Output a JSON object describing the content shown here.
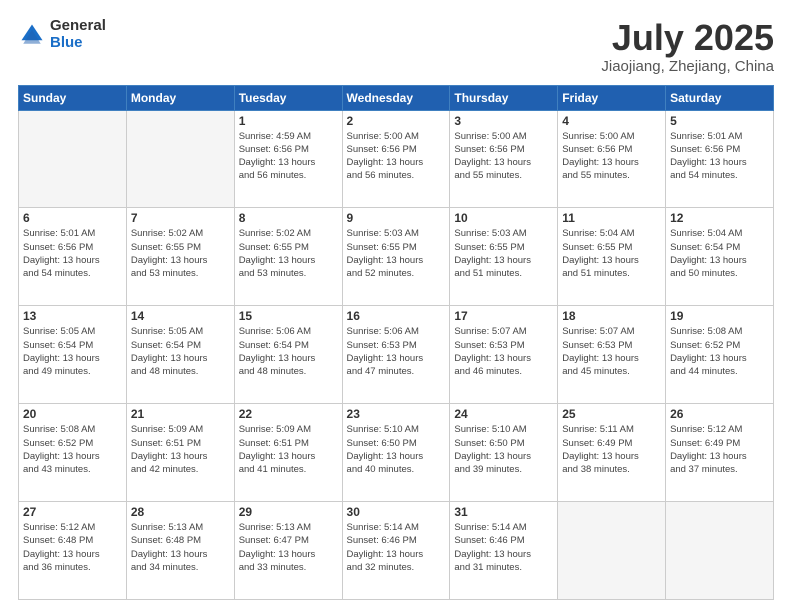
{
  "logo": {
    "general": "General",
    "blue": "Blue"
  },
  "title": {
    "month": "July 2025",
    "location": "Jiaojiang, Zhejiang, China"
  },
  "days_header": [
    "Sunday",
    "Monday",
    "Tuesday",
    "Wednesday",
    "Thursday",
    "Friday",
    "Saturday"
  ],
  "weeks": [
    [
      {
        "day": "",
        "info": ""
      },
      {
        "day": "",
        "info": ""
      },
      {
        "day": "1",
        "info": "Sunrise: 4:59 AM\nSunset: 6:56 PM\nDaylight: 13 hours\nand 56 minutes."
      },
      {
        "day": "2",
        "info": "Sunrise: 5:00 AM\nSunset: 6:56 PM\nDaylight: 13 hours\nand 56 minutes."
      },
      {
        "day": "3",
        "info": "Sunrise: 5:00 AM\nSunset: 6:56 PM\nDaylight: 13 hours\nand 55 minutes."
      },
      {
        "day": "4",
        "info": "Sunrise: 5:00 AM\nSunset: 6:56 PM\nDaylight: 13 hours\nand 55 minutes."
      },
      {
        "day": "5",
        "info": "Sunrise: 5:01 AM\nSunset: 6:56 PM\nDaylight: 13 hours\nand 54 minutes."
      }
    ],
    [
      {
        "day": "6",
        "info": "Sunrise: 5:01 AM\nSunset: 6:56 PM\nDaylight: 13 hours\nand 54 minutes."
      },
      {
        "day": "7",
        "info": "Sunrise: 5:02 AM\nSunset: 6:55 PM\nDaylight: 13 hours\nand 53 minutes."
      },
      {
        "day": "8",
        "info": "Sunrise: 5:02 AM\nSunset: 6:55 PM\nDaylight: 13 hours\nand 53 minutes."
      },
      {
        "day": "9",
        "info": "Sunrise: 5:03 AM\nSunset: 6:55 PM\nDaylight: 13 hours\nand 52 minutes."
      },
      {
        "day": "10",
        "info": "Sunrise: 5:03 AM\nSunset: 6:55 PM\nDaylight: 13 hours\nand 51 minutes."
      },
      {
        "day": "11",
        "info": "Sunrise: 5:04 AM\nSunset: 6:55 PM\nDaylight: 13 hours\nand 51 minutes."
      },
      {
        "day": "12",
        "info": "Sunrise: 5:04 AM\nSunset: 6:54 PM\nDaylight: 13 hours\nand 50 minutes."
      }
    ],
    [
      {
        "day": "13",
        "info": "Sunrise: 5:05 AM\nSunset: 6:54 PM\nDaylight: 13 hours\nand 49 minutes."
      },
      {
        "day": "14",
        "info": "Sunrise: 5:05 AM\nSunset: 6:54 PM\nDaylight: 13 hours\nand 48 minutes."
      },
      {
        "day": "15",
        "info": "Sunrise: 5:06 AM\nSunset: 6:54 PM\nDaylight: 13 hours\nand 48 minutes."
      },
      {
        "day": "16",
        "info": "Sunrise: 5:06 AM\nSunset: 6:53 PM\nDaylight: 13 hours\nand 47 minutes."
      },
      {
        "day": "17",
        "info": "Sunrise: 5:07 AM\nSunset: 6:53 PM\nDaylight: 13 hours\nand 46 minutes."
      },
      {
        "day": "18",
        "info": "Sunrise: 5:07 AM\nSunset: 6:53 PM\nDaylight: 13 hours\nand 45 minutes."
      },
      {
        "day": "19",
        "info": "Sunrise: 5:08 AM\nSunset: 6:52 PM\nDaylight: 13 hours\nand 44 minutes."
      }
    ],
    [
      {
        "day": "20",
        "info": "Sunrise: 5:08 AM\nSunset: 6:52 PM\nDaylight: 13 hours\nand 43 minutes."
      },
      {
        "day": "21",
        "info": "Sunrise: 5:09 AM\nSunset: 6:51 PM\nDaylight: 13 hours\nand 42 minutes."
      },
      {
        "day": "22",
        "info": "Sunrise: 5:09 AM\nSunset: 6:51 PM\nDaylight: 13 hours\nand 41 minutes."
      },
      {
        "day": "23",
        "info": "Sunrise: 5:10 AM\nSunset: 6:50 PM\nDaylight: 13 hours\nand 40 minutes."
      },
      {
        "day": "24",
        "info": "Sunrise: 5:10 AM\nSunset: 6:50 PM\nDaylight: 13 hours\nand 39 minutes."
      },
      {
        "day": "25",
        "info": "Sunrise: 5:11 AM\nSunset: 6:49 PM\nDaylight: 13 hours\nand 38 minutes."
      },
      {
        "day": "26",
        "info": "Sunrise: 5:12 AM\nSunset: 6:49 PM\nDaylight: 13 hours\nand 37 minutes."
      }
    ],
    [
      {
        "day": "27",
        "info": "Sunrise: 5:12 AM\nSunset: 6:48 PM\nDaylight: 13 hours\nand 36 minutes."
      },
      {
        "day": "28",
        "info": "Sunrise: 5:13 AM\nSunset: 6:48 PM\nDaylight: 13 hours\nand 34 minutes."
      },
      {
        "day": "29",
        "info": "Sunrise: 5:13 AM\nSunset: 6:47 PM\nDaylight: 13 hours\nand 33 minutes."
      },
      {
        "day": "30",
        "info": "Sunrise: 5:14 AM\nSunset: 6:46 PM\nDaylight: 13 hours\nand 32 minutes."
      },
      {
        "day": "31",
        "info": "Sunrise: 5:14 AM\nSunset: 6:46 PM\nDaylight: 13 hours\nand 31 minutes."
      },
      {
        "day": "",
        "info": ""
      },
      {
        "day": "",
        "info": ""
      }
    ]
  ]
}
